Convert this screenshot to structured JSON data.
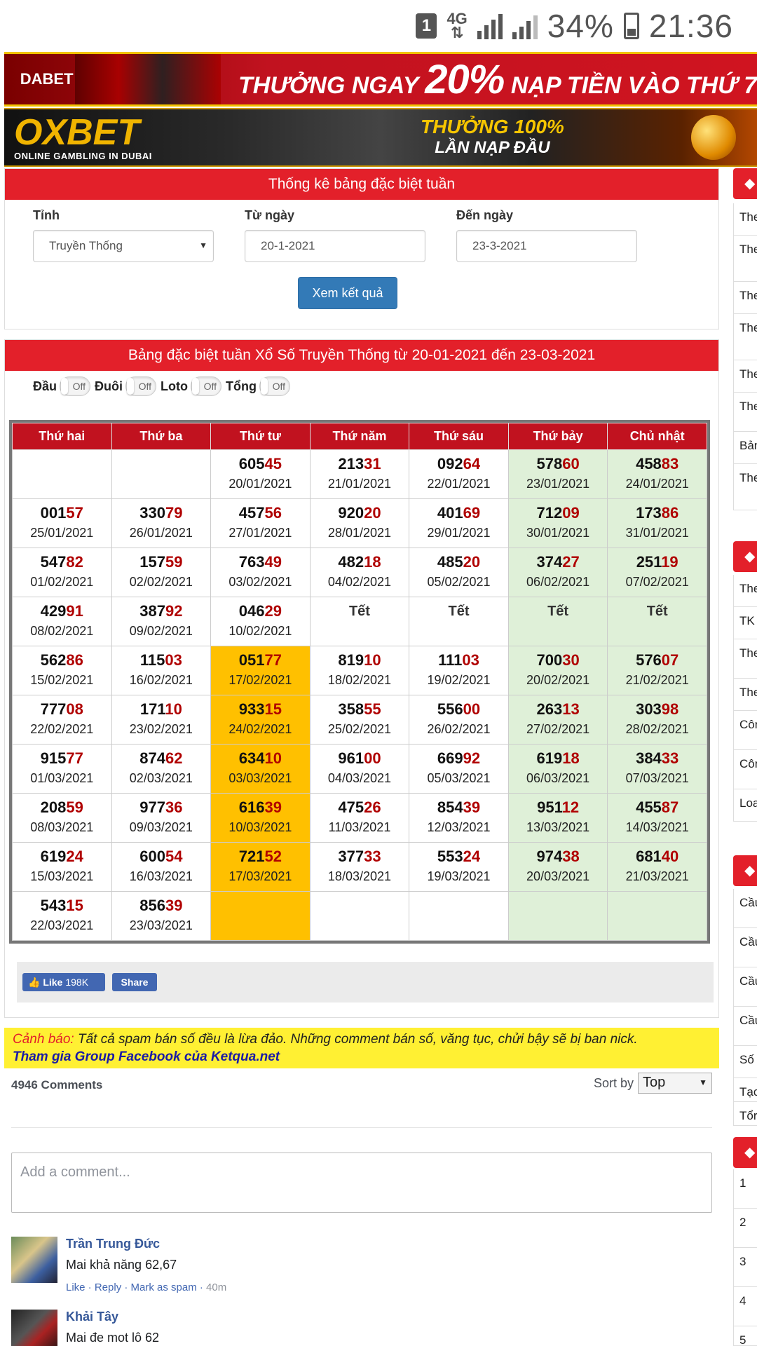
{
  "status_bar": {
    "sim": "1",
    "network": "4G",
    "battery": "34%",
    "time": "21:36"
  },
  "banners": {
    "dabet": {
      "logo": "DABET",
      "text_pre": "THƯỞNG NGAY",
      "text_big": "20%",
      "text_post": "NẠP TIỀN VÀO THỨ 7"
    },
    "oxbet": {
      "logo": "OXBET",
      "tagline": "ONLINE GAMBLING IN DUBAI",
      "line1": "THƯỞNG 100%",
      "line2": "LẦN NẠP ĐẦU"
    }
  },
  "form": {
    "title": "Thống kê bảng đặc biệt tuần",
    "province_label": "Tỉnh",
    "province_value": "Truyền Thống",
    "from_label": "Từ ngày",
    "from_value": "20-1-2021",
    "to_label": "Đến ngày",
    "to_value": "23-3-2021",
    "submit_label": "Xem kết quả"
  },
  "results": {
    "title": "Bảng đặc biệt tuần Xổ Số Truyền Thống từ 20-01-2021 đến 23-03-2021",
    "toggles": [
      {
        "label": "Đầu",
        "state": "Off"
      },
      {
        "label": "Đuôi",
        "state": "Off"
      },
      {
        "label": "Loto",
        "state": "Off"
      },
      {
        "label": "Tổng",
        "state": "Off"
      }
    ],
    "headers": [
      "Thứ hai",
      "Thứ ba",
      "Thứ tư",
      "Thứ năm",
      "Thứ sáu",
      "Thứ bảy",
      "Chủ nhật"
    ],
    "rows": [
      [
        {
          "h": "",
          "t": "",
          "d": ""
        },
        {
          "h": "",
          "t": "",
          "d": ""
        },
        {
          "h": "605",
          "t": "45",
          "d": "20/01/2021"
        },
        {
          "h": "213",
          "t": "31",
          "d": "21/01/2021"
        },
        {
          "h": "092",
          "t": "64",
          "d": "22/01/2021"
        },
        {
          "h": "578",
          "t": "60",
          "d": "23/01/2021"
        },
        {
          "h": "458",
          "t": "83",
          "d": "24/01/2021"
        }
      ],
      [
        {
          "h": "001",
          "t": "57",
          "d": "25/01/2021"
        },
        {
          "h": "330",
          "t": "79",
          "d": "26/01/2021"
        },
        {
          "h": "457",
          "t": "56",
          "d": "27/01/2021"
        },
        {
          "h": "920",
          "t": "20",
          "d": "28/01/2021"
        },
        {
          "h": "401",
          "t": "69",
          "d": "29/01/2021"
        },
        {
          "h": "712",
          "t": "09",
          "d": "30/01/2021"
        },
        {
          "h": "173",
          "t": "86",
          "d": "31/01/2021"
        }
      ],
      [
        {
          "h": "547",
          "t": "82",
          "d": "01/02/2021"
        },
        {
          "h": "157",
          "t": "59",
          "d": "02/02/2021"
        },
        {
          "h": "763",
          "t": "49",
          "d": "03/02/2021"
        },
        {
          "h": "482",
          "t": "18",
          "d": "04/02/2021"
        },
        {
          "h": "485",
          "t": "20",
          "d": "05/02/2021"
        },
        {
          "h": "374",
          "t": "27",
          "d": "06/02/2021"
        },
        {
          "h": "251",
          "t": "19",
          "d": "07/02/2021"
        }
      ],
      [
        {
          "h": "429",
          "t": "91",
          "d": "08/02/2021"
        },
        {
          "h": "387",
          "t": "92",
          "d": "09/02/2021"
        },
        {
          "h": "046",
          "t": "29",
          "d": "10/02/2021"
        },
        {
          "tet": "Tết"
        },
        {
          "tet": "Tết"
        },
        {
          "tet": "Tết"
        },
        {
          "tet": "Tết"
        }
      ],
      [
        {
          "h": "562",
          "t": "86",
          "d": "15/02/2021"
        },
        {
          "h": "115",
          "t": "03",
          "d": "16/02/2021"
        },
        {
          "h": "051",
          "t": "77",
          "d": "17/02/2021"
        },
        {
          "h": "819",
          "t": "10",
          "d": "18/02/2021"
        },
        {
          "h": "111",
          "t": "03",
          "d": "19/02/2021"
        },
        {
          "h": "700",
          "t": "30",
          "d": "20/02/2021"
        },
        {
          "h": "576",
          "t": "07",
          "d": "21/02/2021"
        }
      ],
      [
        {
          "h": "777",
          "t": "08",
          "d": "22/02/2021"
        },
        {
          "h": "171",
          "t": "10",
          "d": "23/02/2021"
        },
        {
          "h": "933",
          "t": "15",
          "d": "24/02/2021"
        },
        {
          "h": "358",
          "t": "55",
          "d": "25/02/2021"
        },
        {
          "h": "556",
          "t": "00",
          "d": "26/02/2021"
        },
        {
          "h": "263",
          "t": "13",
          "d": "27/02/2021"
        },
        {
          "h": "303",
          "t": "98",
          "d": "28/02/2021"
        }
      ],
      [
        {
          "h": "915",
          "t": "77",
          "d": "01/03/2021"
        },
        {
          "h": "874",
          "t": "62",
          "d": "02/03/2021"
        },
        {
          "h": "634",
          "t": "10",
          "d": "03/03/2021"
        },
        {
          "h": "961",
          "t": "00",
          "d": "04/03/2021"
        },
        {
          "h": "669",
          "t": "92",
          "d": "05/03/2021"
        },
        {
          "h": "619",
          "t": "18",
          "d": "06/03/2021"
        },
        {
          "h": "384",
          "t": "33",
          "d": "07/03/2021"
        }
      ],
      [
        {
          "h": "208",
          "t": "59",
          "d": "08/03/2021"
        },
        {
          "h": "977",
          "t": "36",
          "d": "09/03/2021"
        },
        {
          "h": "616",
          "t": "39",
          "d": "10/03/2021"
        },
        {
          "h": "475",
          "t": "26",
          "d": "11/03/2021"
        },
        {
          "h": "854",
          "t": "39",
          "d": "12/03/2021"
        },
        {
          "h": "951",
          "t": "12",
          "d": "13/03/2021"
        },
        {
          "h": "455",
          "t": "87",
          "d": "14/03/2021"
        }
      ],
      [
        {
          "h": "619",
          "t": "24",
          "d": "15/03/2021"
        },
        {
          "h": "600",
          "t": "54",
          "d": "16/03/2021"
        },
        {
          "h": "721",
          "t": "52",
          "d": "17/03/2021"
        },
        {
          "h": "377",
          "t": "33",
          "d": "18/03/2021"
        },
        {
          "h": "553",
          "t": "24",
          "d": "19/03/2021"
        },
        {
          "h": "974",
          "t": "38",
          "d": "20/03/2021"
        },
        {
          "h": "681",
          "t": "40",
          "d": "21/03/2021"
        }
      ],
      [
        {
          "h": "543",
          "t": "15",
          "d": "22/03/2021"
        },
        {
          "h": "856",
          "t": "39",
          "d": "23/03/2021"
        },
        {
          "h": "",
          "t": "",
          "d": ""
        },
        {
          "h": "",
          "t": "",
          "d": ""
        },
        {
          "h": "",
          "t": "",
          "d": ""
        },
        {
          "h": "",
          "t": "",
          "d": ""
        },
        {
          "h": "",
          "t": "",
          "d": ""
        }
      ]
    ],
    "highlighted_column": "Thứ tư",
    "highlighted_from_row": 4,
    "colors": {
      "header": "#c1121f",
      "highlight": "#ffc000",
      "weekend": "#dff0d8",
      "tail": "#b00000"
    }
  },
  "social": {
    "like_label": "Like",
    "like_count": "198K",
    "share_label": "Share"
  },
  "warning": {
    "label": "Cảnh báo:",
    "text": " Tất cả spam bán số đều là lừa đảo. Những comment bán số, văng tục, chửi bậy sẽ bị ban nick.",
    "group_link": "Tham gia Group Facebook của Ketqua.net"
  },
  "comments": {
    "count_label": "4946 Comments",
    "sort_label": "Sort by",
    "sort_value": "Top",
    "input_placeholder": "Add a comment...",
    "items": [
      {
        "name": "Trần Trung Đức",
        "text": "Mai khả năng 62,67",
        "actions": "Like · Reply · Mark as spam · ",
        "time": "40m"
      },
      {
        "name": "Khải Tây",
        "text": "Mai đe mot lô 62",
        "actions": "",
        "time": ""
      }
    ]
  },
  "sidebar_slice": {
    "cells": [
      "The",
      "The lotc",
      "The",
      "The lotc",
      "The",
      "The",
      "Bản",
      "The the",
      "The",
      "TK",
      "The",
      "The",
      "Côn",
      "Côn VIP",
      "Loa",
      "Cầu",
      "Cầu",
      "Cầu",
      "Cầu",
      "Số",
      "Tạc",
      "Tổr",
      "1",
      "2",
      "3",
      "4",
      "5"
    ]
  }
}
